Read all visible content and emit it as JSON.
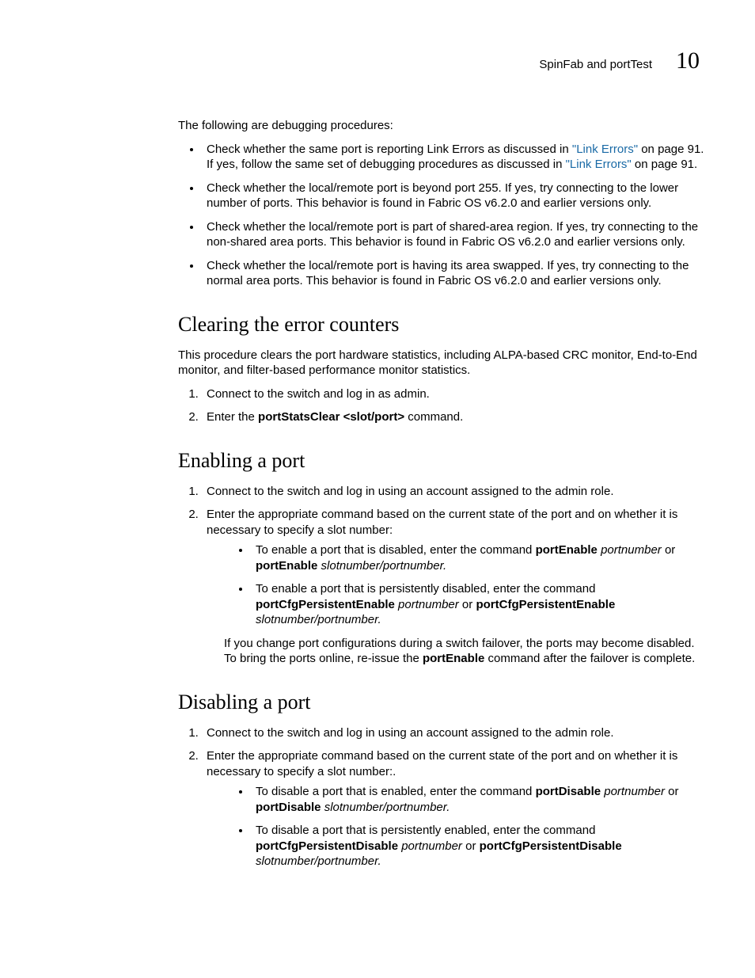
{
  "header": {
    "title": "SpinFab and portTest",
    "chapter": "10"
  },
  "intro": "The following are debugging procedures:",
  "bullets_top": {
    "b1_pre": "Check whether the same port is reporting Link Errors as discussed in ",
    "b1_link1": "\"Link Errors\"",
    "b1_mid1": " on page 91. If yes, follow the same set of debugging procedures as discussed in ",
    "b1_link2": "\"Link Errors\"",
    "b1_mid2": " on page 91.",
    "b2": "Check whether the local/remote port is beyond port 255. If yes, try connecting to the lower number of ports. This behavior is found in Fabric OS v6.2.0 and earlier versions only.",
    "b3": "Check whether the local/remote port is part of shared-area region. If yes, try connecting to the non-shared area ports. This behavior is found in Fabric OS v6.2.0 and earlier versions only.",
    "b4": "Check whether the local/remote port is having its area swapped. If yes, try connecting to the normal area ports. This behavior is found in Fabric OS v6.2.0 and earlier versions only."
  },
  "section_clearing": {
    "heading": "Clearing the error counters",
    "para": "This procedure clears the port hardware statistics, including ALPA-based CRC monitor, End-to-End monitor, and filter-based performance monitor statistics.",
    "step1": "Connect to the switch and log in as admin.",
    "step2_pre": "Enter the ",
    "step2_cmd": "portStatsClear <slot/port>",
    "step2_post": " command."
  },
  "section_enabling": {
    "heading": "Enabling a port",
    "step1": "Connect to the switch and log in using an account assigned to the admin role.",
    "step2_intro": "Enter the appropriate command based on the current state of the port and on whether it is necessary to specify a slot number:",
    "sub1_pre": "To enable a port that is disabled, enter the command ",
    "sub1_cmd1": "portEnable",
    "sub1_mid1": " ",
    "sub1_it1": "portnumber",
    "sub1_mid2": " or ",
    "sub1_cmd2": "portEnable",
    "sub1_mid3": " ",
    "sub1_it2": "slotnumber/portnumber.",
    "sub2_pre": "To enable a port that is persistently disabled, enter the command ",
    "sub2_cmd1": "portCfgPersistentEnable",
    "sub2_mid1": " ",
    "sub2_it1": "portnumber",
    "sub2_mid2": " or ",
    "sub2_cmd2": "portCfgPersistentEnable",
    "sub2_mid3": " ",
    "sub2_it2": "slotnumber/portnumber.",
    "after_pre": "If you change port configurations during a switch failover, the ports may become disabled. To bring the ports online, re-issue the ",
    "after_cmd": "portEnable",
    "after_post": " command after the failover is complete."
  },
  "section_disabling": {
    "heading": "Disabling a port",
    "step1": "Connect to the switch and log in using an account assigned to the admin role.",
    "step2_intro": "Enter the appropriate command based on the current state of the port and on whether it is necessary to specify a slot number:.",
    "sub1_pre": "To disable a port that is enabled, enter the command ",
    "sub1_cmd1": "portDisable",
    "sub1_mid1": " ",
    "sub1_it1": "portnumber",
    "sub1_mid2": " or ",
    "sub1_cmd2": "portDisable",
    "sub1_mid3": " ",
    "sub1_it2": "slotnumber/portnumber.",
    "sub2_pre": "To disable a port that is persistently enabled, enter the command ",
    "sub2_cmd1": "portCfgPersistentDisable",
    "sub2_mid1": " ",
    "sub2_it1": "portnumber",
    "sub2_mid2": " or ",
    "sub2_cmd2": "portCfgPersistentDisable",
    "sub2_mid3": " ",
    "sub2_it2": "slotnumber/portnumber."
  }
}
